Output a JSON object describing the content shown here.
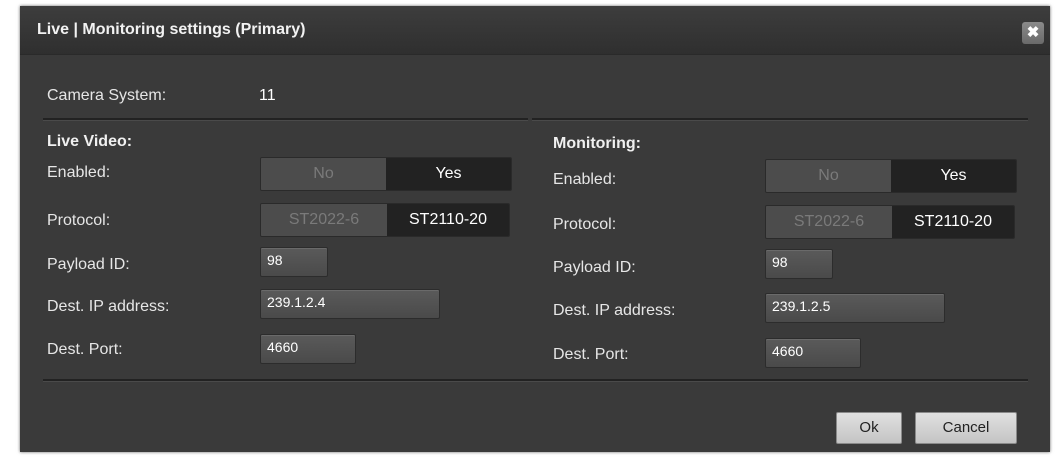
{
  "dialog": {
    "title": "Live | Monitoring settings (Primary)",
    "close_icon": "close-icon"
  },
  "camera_system": {
    "label": "Camera System:",
    "value": "11"
  },
  "live_video": {
    "heading": "Live Video:",
    "enabled_label": "Enabled:",
    "enabled_options": [
      "No",
      "Yes"
    ],
    "enabled_selected": "Yes",
    "protocol_label": "Protocol:",
    "protocol_options": [
      "ST2022-6",
      "ST2110-20"
    ],
    "protocol_selected": "ST2110-20",
    "payload_label": "Payload ID:",
    "payload_value": "98",
    "ip_label": "Dest. IP address:",
    "ip_value": "239.1.2.4",
    "port_label": "Dest. Port:",
    "port_value": "4660"
  },
  "monitoring": {
    "heading": "Monitoring:",
    "enabled_label": "Enabled:",
    "enabled_options": [
      "No",
      "Yes"
    ],
    "enabled_selected": "Yes",
    "protocol_label": "Protocol:",
    "protocol_options": [
      "ST2022-6",
      "ST2110-20"
    ],
    "protocol_selected": "ST2110-20",
    "payload_label": "Payload ID:",
    "payload_value": "98",
    "ip_label": "Dest. IP address:",
    "ip_value": "239.1.2.5",
    "port_label": "Dest. Port:",
    "port_value": "4660"
  },
  "footer": {
    "ok_label": "Ok",
    "cancel_label": "Cancel"
  }
}
